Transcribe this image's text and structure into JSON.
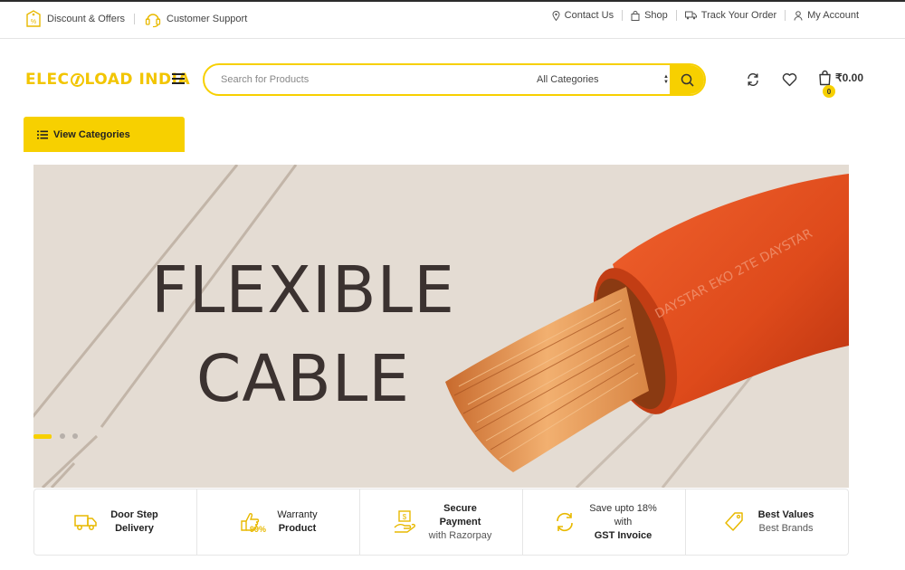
{
  "topbar": {
    "discount_label": "Discount & Offers",
    "support_label": "Customer Support",
    "contact_label": "Contact Us",
    "shop_label": "Shop",
    "track_label": "Track Your Order",
    "account_label": "My Account"
  },
  "header": {
    "logo_part1": "ELEC",
    "logo_part2": "LOAD INDIA",
    "search_placeholder": "Search for Products",
    "category_selected": "All Categories",
    "cart_count": "0",
    "cart_total": "₹0.00"
  },
  "nav": {
    "view_categories": "View Categories"
  },
  "banner": {
    "line1": "FLEXIBLE",
    "line2": "CABLE",
    "cable_print": "DAYSTAR EKO 2TE DAYSTAR"
  },
  "features": [
    {
      "icon": "truck-icon",
      "line1": "Door Step",
      "line2": "Delivery"
    },
    {
      "icon": "thumbs-up-99-icon",
      "line1": "Warranty",
      "line2": "Product"
    },
    {
      "icon": "secure-payment-icon",
      "line1": "Secure",
      "line2": "Payment",
      "line3": "with Razorpay"
    },
    {
      "icon": "refresh-percent-icon",
      "line1": "Save upto 18%",
      "line2": "with",
      "line3": "GST Invoice"
    },
    {
      "icon": "tag-icon",
      "line1": "Best Values",
      "line2": "Best Brands"
    }
  ],
  "colors": {
    "accent": "#f7d000",
    "logo": "#f2c500",
    "banner_bg": "#e4dcd3",
    "headline": "#3b3230",
    "cable": "#e04a1e"
  }
}
